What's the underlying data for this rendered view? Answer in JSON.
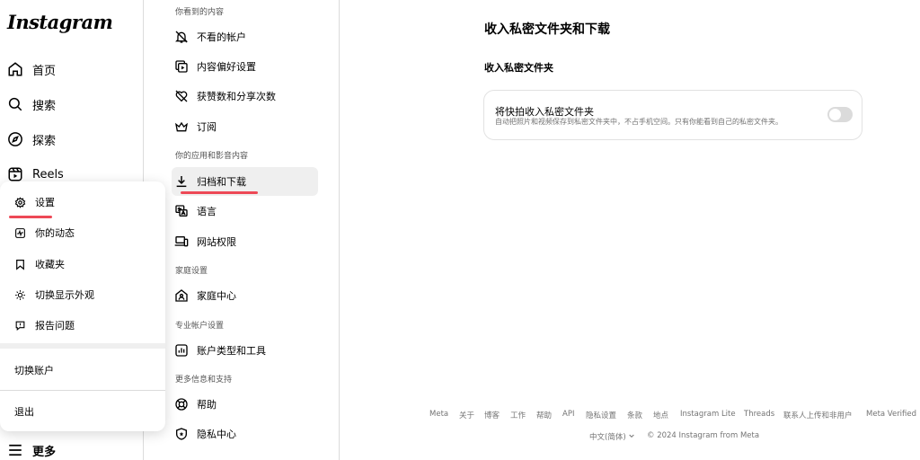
{
  "logo": "Instagram",
  "nav": {
    "home": "首页",
    "search": "搜索",
    "explore": "探索",
    "reels": "Reels",
    "more": "更多"
  },
  "more_menu": {
    "items": [
      "设置",
      "你的动态",
      "收藏夹",
      "切换显示外观",
      "报告问题"
    ],
    "switch_account": "切换账户",
    "logout": "退出"
  },
  "settings_menu": {
    "section_what_you_see": "你看到的内容",
    "not_seen_accounts": "不看的帐户",
    "content_preferences": "内容偏好设置",
    "like_share_counts": "获赞数和分享次数",
    "subscriptions": "订阅",
    "section_apps_media": "你的应用和影音内容",
    "archive_download": "归档和下载",
    "language": "语言",
    "website_permissions": "网站权限",
    "section_family": "家庭设置",
    "family_center": "家庭中心",
    "section_professional": "专业帐户设置",
    "account_type_tools": "账户类型和工具",
    "section_more_info": "更多信息和支持",
    "help": "帮助",
    "privacy_center": "隐私中心"
  },
  "main": {
    "title": "收入私密文件夹和下载",
    "subtitle": "收入私密文件夹",
    "card_label": "将快拍收入私密文件夹",
    "card_desc": "自动把照片和视频保存到私密文件夹中，不占手机空间。只有你能看到自己的私密文件夹。",
    "toggle_on": false
  },
  "footer": {
    "links": [
      "Meta",
      "关于",
      "博客",
      "工作",
      "帮助",
      "API",
      "隐私设置",
      "条款",
      "地点",
      "Instagram Lite",
      "Threads",
      "联系人上传和非用户",
      "Meta Verified"
    ],
    "language": "中文(简体)",
    "copyright": "© 2024 Instagram from Meta"
  },
  "colors": {
    "accent_underline": "#ed4956",
    "active_bg": "#efefef",
    "toggle_off": "#dbdbdb"
  }
}
